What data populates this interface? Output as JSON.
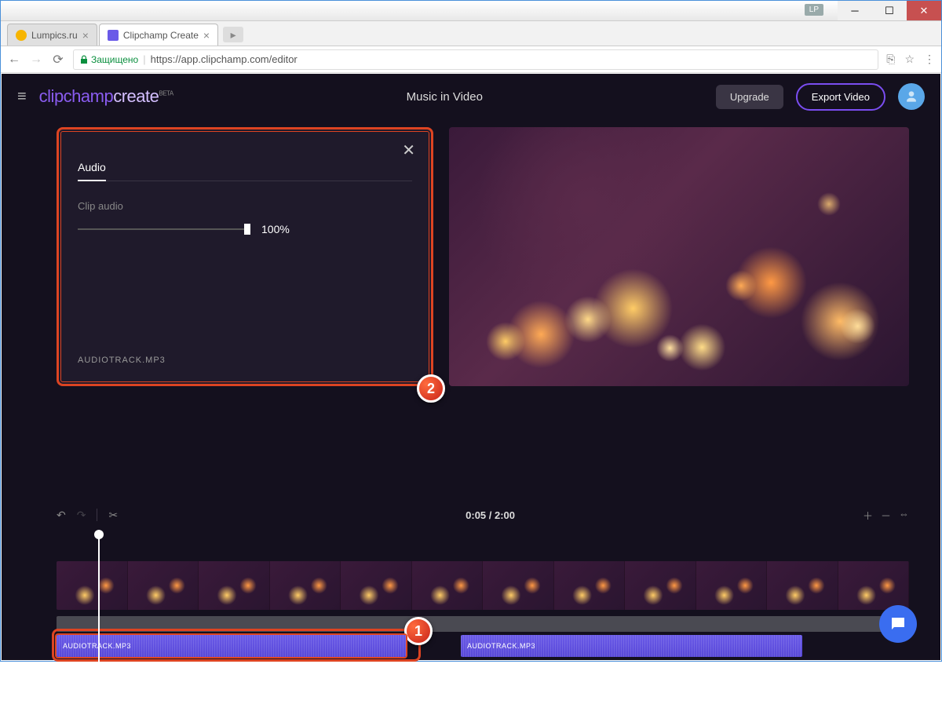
{
  "browser": {
    "user_badge": "LP",
    "tabs": [
      {
        "title": "Lumpics.ru",
        "favicon_color": "#f7b500"
      },
      {
        "title": "Clipchamp Create",
        "favicon_color": "#6a5ae8"
      }
    ],
    "url_secure_label": "Защищено",
    "url": "https://app.clipchamp.com/editor"
  },
  "app": {
    "logo": {
      "part1": "clipchamp",
      "part2": "create",
      "beta": "BETA"
    },
    "project_title": "Music in Video",
    "upgrade_label": "Upgrade",
    "export_label": "Export Video"
  },
  "panel": {
    "tab_label": "Audio",
    "clip_audio_label": "Clip audio",
    "volume_value": "100%",
    "filename": "AUDIOTRACK.MP3"
  },
  "timeline": {
    "time_display": "0:05 / 2:00",
    "audio_clips": [
      {
        "label": "AUDIOTRACK.MP3"
      },
      {
        "label": "AUDIOTRACK.MP3"
      }
    ]
  },
  "annotations": {
    "badge1": "1",
    "badge2": "2"
  }
}
